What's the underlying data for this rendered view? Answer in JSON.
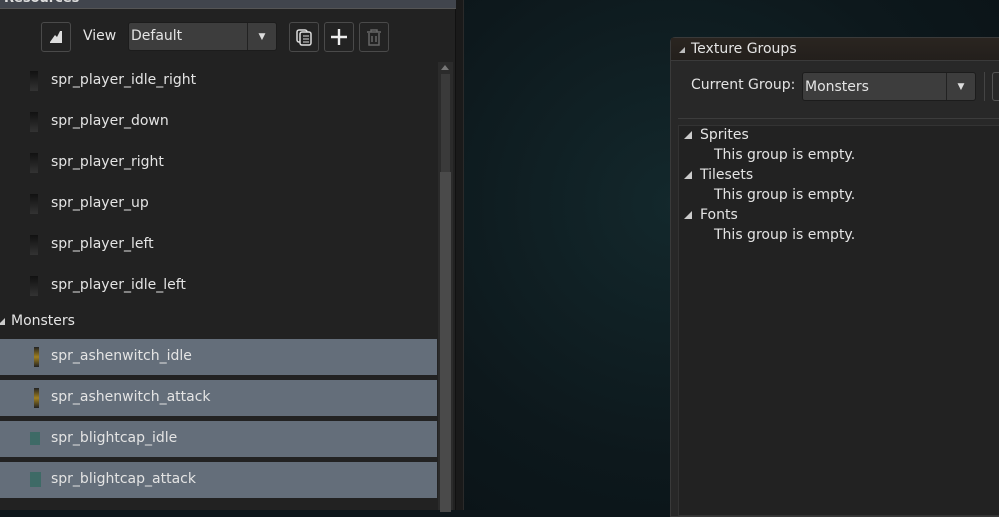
{
  "resources_panel": {
    "header_title": "Resources",
    "toolbar": {
      "view_label": "View",
      "view_value": "Default"
    },
    "items": [
      {
        "name": "spr_player_idle_right"
      },
      {
        "name": "spr_player_down"
      },
      {
        "name": "spr_player_right"
      },
      {
        "name": "spr_player_up"
      },
      {
        "name": "spr_player_left"
      },
      {
        "name": "spr_player_idle_left"
      }
    ],
    "group": {
      "name": "Monsters"
    },
    "group_items": [
      {
        "name": "spr_ashenwitch_idle"
      },
      {
        "name": "spr_ashenwitch_attack"
      },
      {
        "name": "spr_blightcap_idle"
      },
      {
        "name": "spr_blightcap_attack"
      }
    ],
    "selected_color": "#646e7a"
  },
  "texture_groups": {
    "title": "Texture Groups",
    "current_group_label": "Current Group:",
    "current_group_value": "Monsters",
    "sections": [
      {
        "name": "Sprites",
        "empty_text": "This group is empty."
      },
      {
        "name": "Tilesets",
        "empty_text": "This group is empty."
      },
      {
        "name": "Fonts",
        "empty_text": "This group is empty."
      }
    ]
  }
}
